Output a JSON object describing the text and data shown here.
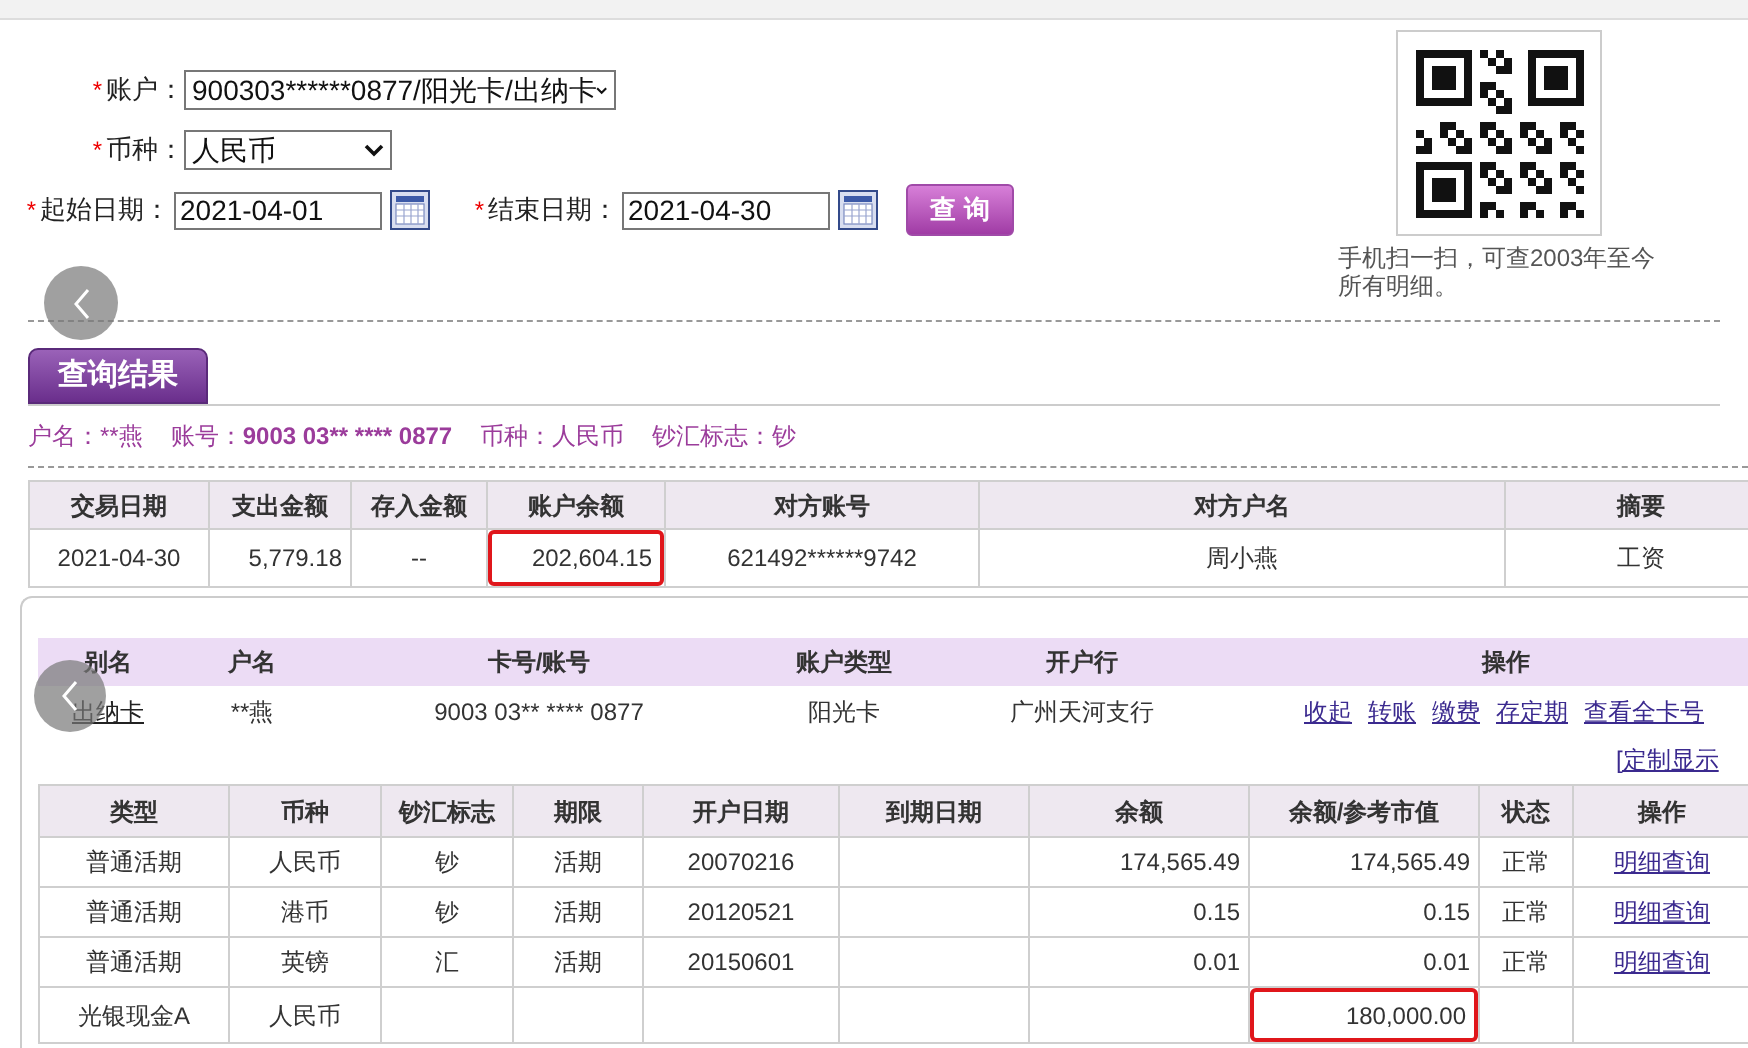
{
  "form": {
    "fields": [
      {
        "kind": "select",
        "required_mark": "*",
        "label": "账户：",
        "value": "900303******0877/阳光卡/出纳卡"
      },
      {
        "kind": "select",
        "required_mark": "*",
        "label": "币种：",
        "value": "人民币"
      },
      {
        "kind": "date",
        "required_mark": "*",
        "label": "起始日期：",
        "value": "2021-04-01"
      },
      {
        "kind": "date",
        "required_mark": "*",
        "label": "结束日期：",
        "value": "2021-04-30"
      }
    ],
    "query_button": "查 询"
  },
  "qr": {
    "caption": "手机扫一扫，可查2003年至今所有明细。"
  },
  "tabs": [
    {
      "label": "查询结果",
      "selected": true
    }
  ],
  "account_info": [
    {
      "label": "户名：",
      "value": "**燕",
      "emphasis": false
    },
    {
      "label": "账号：",
      "value": "9003 03** **** 0877",
      "emphasis": true
    },
    {
      "label": "币种：",
      "value": "人民币",
      "emphasis": false
    },
    {
      "label": "钞汇标志：",
      "value": "钞",
      "emphasis": false
    }
  ],
  "transactions": {
    "columns": [
      {
        "label": "交易日期",
        "kind": "text"
      },
      {
        "label": "支出金额",
        "kind": "number"
      },
      {
        "label": "存入金额",
        "kind": "text"
      },
      {
        "label": "账户余额",
        "kind": "number"
      },
      {
        "label": "对方账号",
        "kind": "text"
      },
      {
        "label": "对方户名",
        "kind": "text"
      },
      {
        "label": "摘要",
        "kind": "text"
      }
    ],
    "rows": [
      {
        "cells": [
          "2021-04-30",
          "5,779.18",
          "--",
          "202,604.15",
          "621492******9742",
          "周小燕",
          "工资"
        ],
        "highlighted": [
          false,
          false,
          false,
          true,
          false,
          false,
          false
        ]
      }
    ]
  },
  "accounts_panel": {
    "columns": [
      "别名",
      "户名",
      "卡号/账号",
      "账户类型",
      "开户行",
      "操作"
    ],
    "row": {
      "alias": "出纳卡",
      "name": "**燕",
      "card_number": "9003 03** **** 0877",
      "account_type": "阳光卡",
      "branch": "广州天河支行",
      "actions": [
        "收起",
        "转账",
        "缴费",
        "存定期",
        "查看全卡号"
      ]
    },
    "customize_link": "[定制显示",
    "sub_accounts": {
      "columns": [
        {
          "label": "类型",
          "kind": "text"
        },
        {
          "label": "币种",
          "kind": "text"
        },
        {
          "label": "钞汇标志",
          "kind": "text"
        },
        {
          "label": "期限",
          "kind": "text"
        },
        {
          "label": "开户日期",
          "kind": "text"
        },
        {
          "label": "到期日期",
          "kind": "text"
        },
        {
          "label": "余额",
          "kind": "number"
        },
        {
          "label": "余额/参考市值",
          "kind": "number"
        },
        {
          "label": "状态",
          "kind": "text"
        },
        {
          "label": "操作",
          "kind": "link"
        }
      ],
      "rows": [
        {
          "cells": [
            "普通活期",
            "人民币",
            "钞",
            "活期",
            "20070216",
            null,
            "174,565.49",
            "174,565.49",
            "正常",
            "明细查询"
          ],
          "highlighted": [
            false,
            false,
            false,
            false,
            false,
            false,
            false,
            false,
            false,
            false
          ]
        },
        {
          "cells": [
            "普通活期",
            "港币",
            "钞",
            "活期",
            "20120521",
            null,
            "0.15",
            "0.15",
            "正常",
            "明细查询"
          ],
          "highlighted": [
            false,
            false,
            false,
            false,
            false,
            false,
            false,
            false,
            false,
            false
          ]
        },
        {
          "cells": [
            "普通活期",
            "英镑",
            "汇",
            "活期",
            "20150601",
            null,
            "0.01",
            "0.01",
            "正常",
            "明细查询"
          ],
          "highlighted": [
            false,
            false,
            false,
            false,
            false,
            false,
            false,
            false,
            false,
            false
          ]
        },
        {
          "cells": [
            "光银现金A",
            "人民币",
            null,
            null,
            null,
            null,
            null,
            "180,000.00",
            null,
            null
          ],
          "highlighted": [
            false,
            false,
            false,
            false,
            false,
            false,
            false,
            true,
            false,
            false
          ]
        }
      ]
    }
  }
}
